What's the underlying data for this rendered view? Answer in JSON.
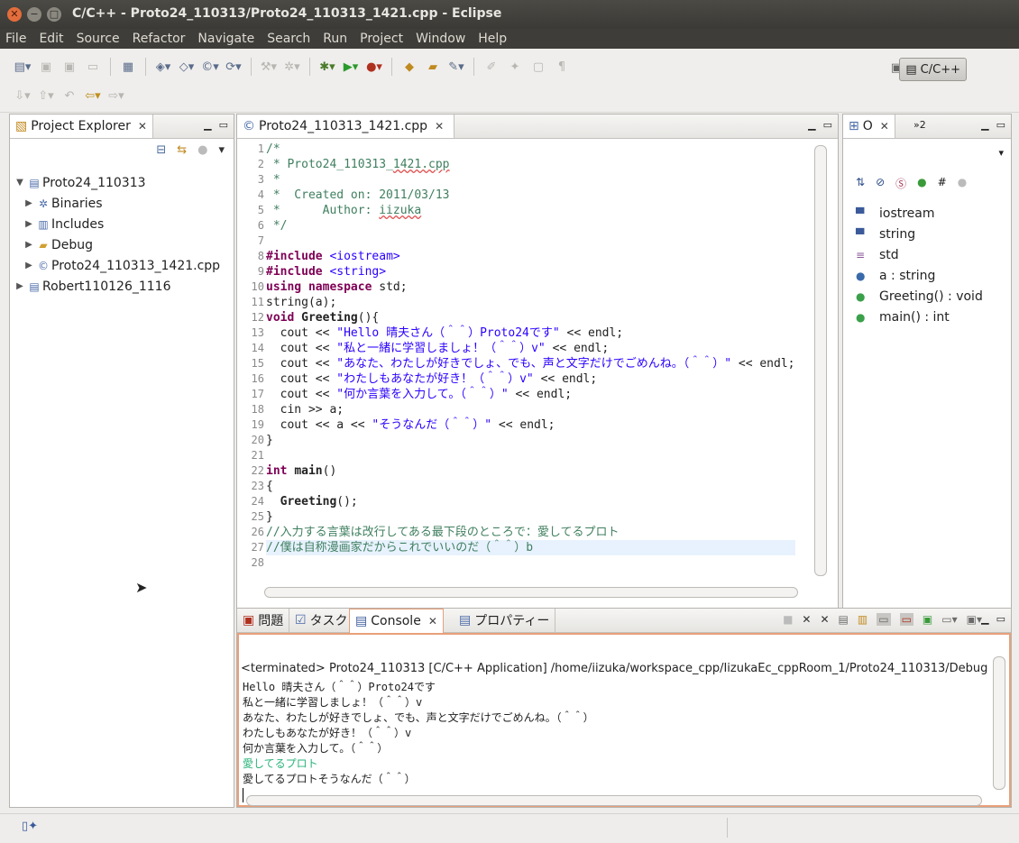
{
  "window": {
    "title": "C/C++ - Proto24_110313/Proto24_110313_1421.cpp - Eclipse",
    "close_glyph": "✕",
    "min_glyph": "−",
    "max_glyph": "□"
  },
  "menu": [
    "File",
    "Edit",
    "Source",
    "Refactor",
    "Navigate",
    "Search",
    "Run",
    "Project",
    "Window",
    "Help"
  ],
  "perspective": {
    "label": "C/C++"
  },
  "project_explorer": {
    "title": "Project Explorer",
    "items": [
      {
        "label": "Proto24_110313",
        "indent": 0,
        "expanded": true,
        "icon": "project-icon"
      },
      {
        "label": "Binaries",
        "indent": 1,
        "expanded": false,
        "icon": "binaries-icon"
      },
      {
        "label": "Includes",
        "indent": 1,
        "expanded": false,
        "icon": "includes-icon"
      },
      {
        "label": "Debug",
        "indent": 1,
        "expanded": false,
        "icon": "folder-icon"
      },
      {
        "label": "Proto24_110313_1421.cpp",
        "indent": 1,
        "expanded": false,
        "icon": "cpp-file-icon"
      },
      {
        "label": "Robert110126_1116",
        "indent": 0,
        "expanded": false,
        "icon": "project-icon"
      }
    ]
  },
  "editor": {
    "tab_label": "Proto24_110313_1421.cpp",
    "lines": [
      "/*",
      " * Proto24_110313_1421.cpp",
      " *",
      " *  Created on: 2011/03/13",
      " *      Author: iizuka",
      " */",
      "",
      "#include <iostream>",
      "#include <string>",
      "using namespace std;",
      "string(a);",
      "void Greeting(){",
      "  cout << \"Hello 晴夫さん（＾＾）Proto24です\" << endl;",
      "  cout << \"私と一緒に学習しましょ！（＾＾）v\" << endl;",
      "  cout << \"あなた、わたしが好きでしょ、でも、声と文字だけでごめんね。（＾＾）\" << endl;",
      "  cout << \"わたしもあなたが好き！（＾＾）v\" << endl;",
      "  cout << \"何か言葉を入力して。（＾＾）\" << endl;",
      "  cin >> a;",
      "  cout << a << \"そうなんだ（＾＾）\" << endl;",
      "}",
      "",
      "int main()",
      "{",
      "  Greeting();",
      "}",
      "//入力する言葉は改行してある最下段のところで：愛してるプロト",
      "//僕は自称漫画家だからこれでいいのだ（＾＾）b",
      ""
    ]
  },
  "outline": {
    "tab_label": "O",
    "tab2_label": "»2",
    "items": [
      {
        "label": "iostream",
        "icon": "include-icon"
      },
      {
        "label": "string",
        "icon": "include-icon"
      },
      {
        "label": "std",
        "icon": "namespace-icon"
      },
      {
        "label": "a : string",
        "icon": "variable-icon"
      },
      {
        "label": "Greeting() : void",
        "icon": "method-icon"
      },
      {
        "label": "main() : int",
        "icon": "method-icon"
      }
    ]
  },
  "bottom_tabs": [
    {
      "label": "問題",
      "active": false
    },
    {
      "label": "タスク",
      "active": false
    },
    {
      "label": "Console",
      "active": true
    },
    {
      "label": "プロパティー",
      "active": false
    }
  ],
  "console": {
    "header": "<terminated> Proto24_110313 [C/C++ Application] /home/iizuka/workspace_cpp/IizukaEc_cppRoom_1/Proto24_110313/Debug",
    "lines": [
      {
        "text": "Hello 晴夫さん（＾＾）Proto24です",
        "input": false
      },
      {
        "text": "私と一緒に学習しましょ！（＾＾）v",
        "input": false
      },
      {
        "text": "あなた、わたしが好きでしょ、でも、声と文字だけでごめんね。（＾＾）",
        "input": false
      },
      {
        "text": "わたしもあなたが好き！（＾＾）v",
        "input": false
      },
      {
        "text": "何か言葉を入力して。（＾＾）",
        "input": false
      },
      {
        "text": "愛してるプロト",
        "input": true
      },
      {
        "text": "愛してるプロトそうなんだ（＾＾）",
        "input": false
      }
    ]
  },
  "colors": {
    "comment": "#3f7f5f",
    "keyword": "#7f0055",
    "string": "#2a00ff",
    "console_input": "#2bb37a",
    "console_border": "#e8a07a"
  }
}
